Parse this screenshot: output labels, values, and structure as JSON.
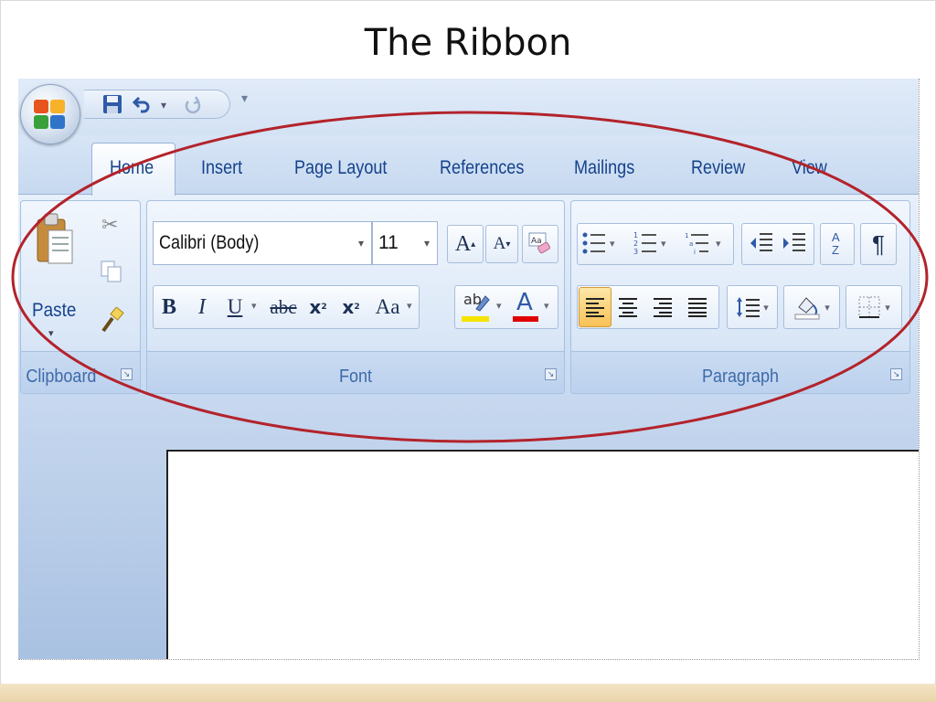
{
  "slide": {
    "title": "The Ribbon"
  },
  "quick_access": {
    "save_icon": "save-icon",
    "undo_icon": "undo-icon",
    "redo_icon": "redo-icon",
    "customize": "customize-quick-access-icon"
  },
  "tabs": [
    {
      "label": "Home"
    },
    {
      "label": "Insert"
    },
    {
      "label": "Page Layout"
    },
    {
      "label": "References"
    },
    {
      "label": "Mailings"
    },
    {
      "label": "Review"
    },
    {
      "label": "View"
    }
  ],
  "clipboard": {
    "label": "Clipboard",
    "paste_label": "Paste"
  },
  "font": {
    "label": "Font",
    "font_name": "Calibri (Body)",
    "font_size": "11",
    "bold": "B",
    "italic": "I",
    "underline": "U",
    "strikethrough": "abc",
    "subscript": "x",
    "superscript": "x",
    "change_case": "Aa",
    "highlight": "ab",
    "font_color": "A",
    "grow": "A",
    "shrink": "A",
    "clear": "Aa",
    "highlight_color": "#f5e400",
    "font_color_value": "#e00000"
  },
  "paragraph": {
    "label": "Paragraph",
    "sort": "A Z",
    "pilcrow": "¶"
  },
  "annotation": {
    "color": "#b3232b"
  }
}
